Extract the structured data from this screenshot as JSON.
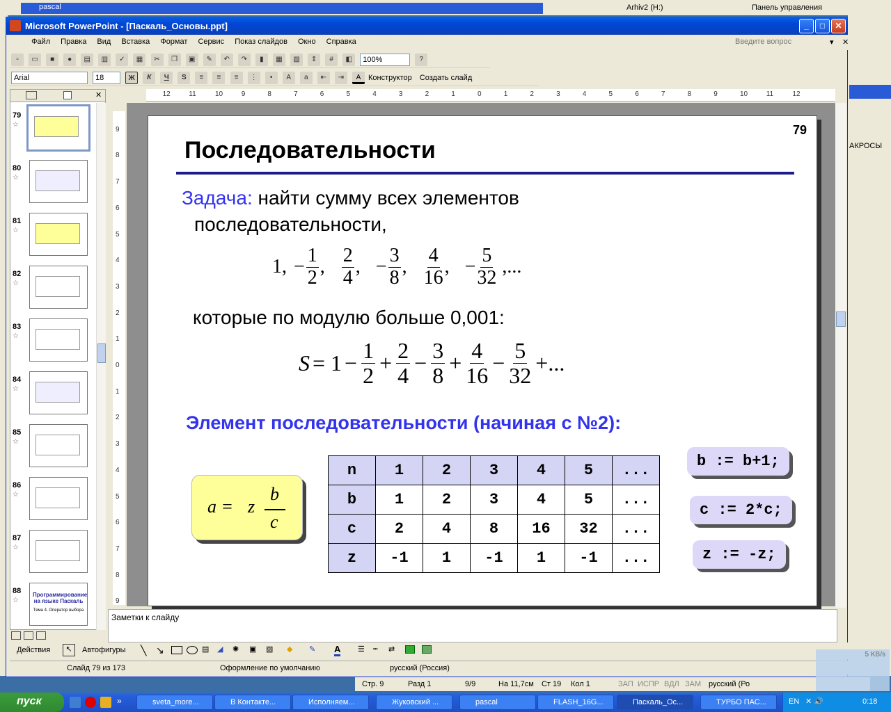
{
  "background": {
    "top_left_title": "pascal",
    "top_right_items": [
      "Arhiv2 (H:)",
      "Панель управления"
    ],
    "right_window_label": "АКРОСЫ"
  },
  "app": {
    "title": "Microsoft PowerPoint - [Паскаль_Основы.ppt]",
    "ask_placeholder": "Введите вопрос"
  },
  "menu": [
    "Файл",
    "Правка",
    "Вид",
    "Вставка",
    "Формат",
    "Сервис",
    "Показ слайдов",
    "Окно",
    "Справка"
  ],
  "toolbar": {
    "zoom": "100%",
    "font": "Arial",
    "size": "18",
    "bold": "Ж",
    "italic": "К",
    "underline": "Ч",
    "shadow": "S",
    "designer": "Конструктор",
    "new_slide": "Создать слайд"
  },
  "slides_panel": {
    "items": [
      {
        "num": "79"
      },
      {
        "num": "80"
      },
      {
        "num": "81"
      },
      {
        "num": "82"
      },
      {
        "num": "83"
      },
      {
        "num": "84"
      },
      {
        "num": "85"
      },
      {
        "num": "86"
      },
      {
        "num": "87"
      },
      {
        "num": "88"
      }
    ],
    "thumb88_text": "Программирование на языке Паскаль",
    "thumb88_sub": "Тема 4. Оператор выбора"
  },
  "slide": {
    "page_number": "79",
    "title": "Последовательности",
    "task_label": "Задача:",
    "task_text1": "найти сумму всех элементов",
    "task_text2": "последовательности,",
    "seq_first": "1,",
    "seq": [
      {
        "sign": "−",
        "n": "1",
        "d": "2"
      },
      {
        "sign": "",
        "n": "2",
        "d": "4"
      },
      {
        "sign": "−",
        "n": "3",
        "d": "8"
      },
      {
        "sign": "",
        "n": "4",
        "d": "16"
      },
      {
        "sign": "−",
        "n": "5",
        "d": "32"
      }
    ],
    "seq_end": ",...",
    "condition": "которые по модулю больше 0,001:",
    "sum_lhs": "S",
    "sum_eq": "= 1",
    "sum_terms": [
      {
        "op": "−",
        "n": "1",
        "d": "2"
      },
      {
        "op": "+",
        "n": "2",
        "d": "4"
      },
      {
        "op": "−",
        "n": "3",
        "d": "8"
      },
      {
        "op": "+",
        "n": "4",
        "d": "16"
      },
      {
        "op": "−",
        "n": "5",
        "d": "32"
      }
    ],
    "sum_end": "+...",
    "element_heading": "Элемент последовательности (начиная с №2):",
    "formula": {
      "lhs": "a =",
      "z": "z",
      "n": "b",
      "d": "c"
    },
    "table": [
      [
        "n",
        "1",
        "2",
        "3",
        "4",
        "5",
        "..."
      ],
      [
        "b",
        "1",
        "2",
        "3",
        "4",
        "5",
        "..."
      ],
      [
        "c",
        "2",
        "4",
        "8",
        "16",
        "32",
        "..."
      ],
      [
        "z",
        "-1",
        "1",
        "-1",
        "1",
        "-1",
        "..."
      ]
    ],
    "callouts": [
      "b := b+1;",
      "c := 2*c;",
      "z := -z;"
    ]
  },
  "notes_placeholder": "Заметки к слайду",
  "drawbar": {
    "actions": "Действия",
    "autoshapes": "Автофигуры"
  },
  "status": {
    "slide": "Слайд 79 из 173",
    "design": "Оформление по умолчанию",
    "lang": "русский (Россия)"
  },
  "status2": {
    "page": "Стр. 9",
    "section": "Разд 1",
    "pages": "9/9",
    "pos": "На 11,7см",
    "line": "Ст 19",
    "col": "Кол 1",
    "rec": "ЗАП",
    "trk": "ИСПР",
    "ext": "ВДЛ",
    "ovr": "ЗАМ",
    "lang": "русский (Ро"
  },
  "net_speed": "5 KB/s",
  "taskbar": {
    "start": "пуск",
    "tasks": [
      "sveta_more...",
      "В Контакте...",
      "Исполняем...",
      "Жуковский ...",
      "pascal",
      "FLASH_16G...",
      "Паскаль_Ос...",
      "ТУРБО ПАС..."
    ],
    "lang": "EN",
    "clock": "0:18"
  }
}
